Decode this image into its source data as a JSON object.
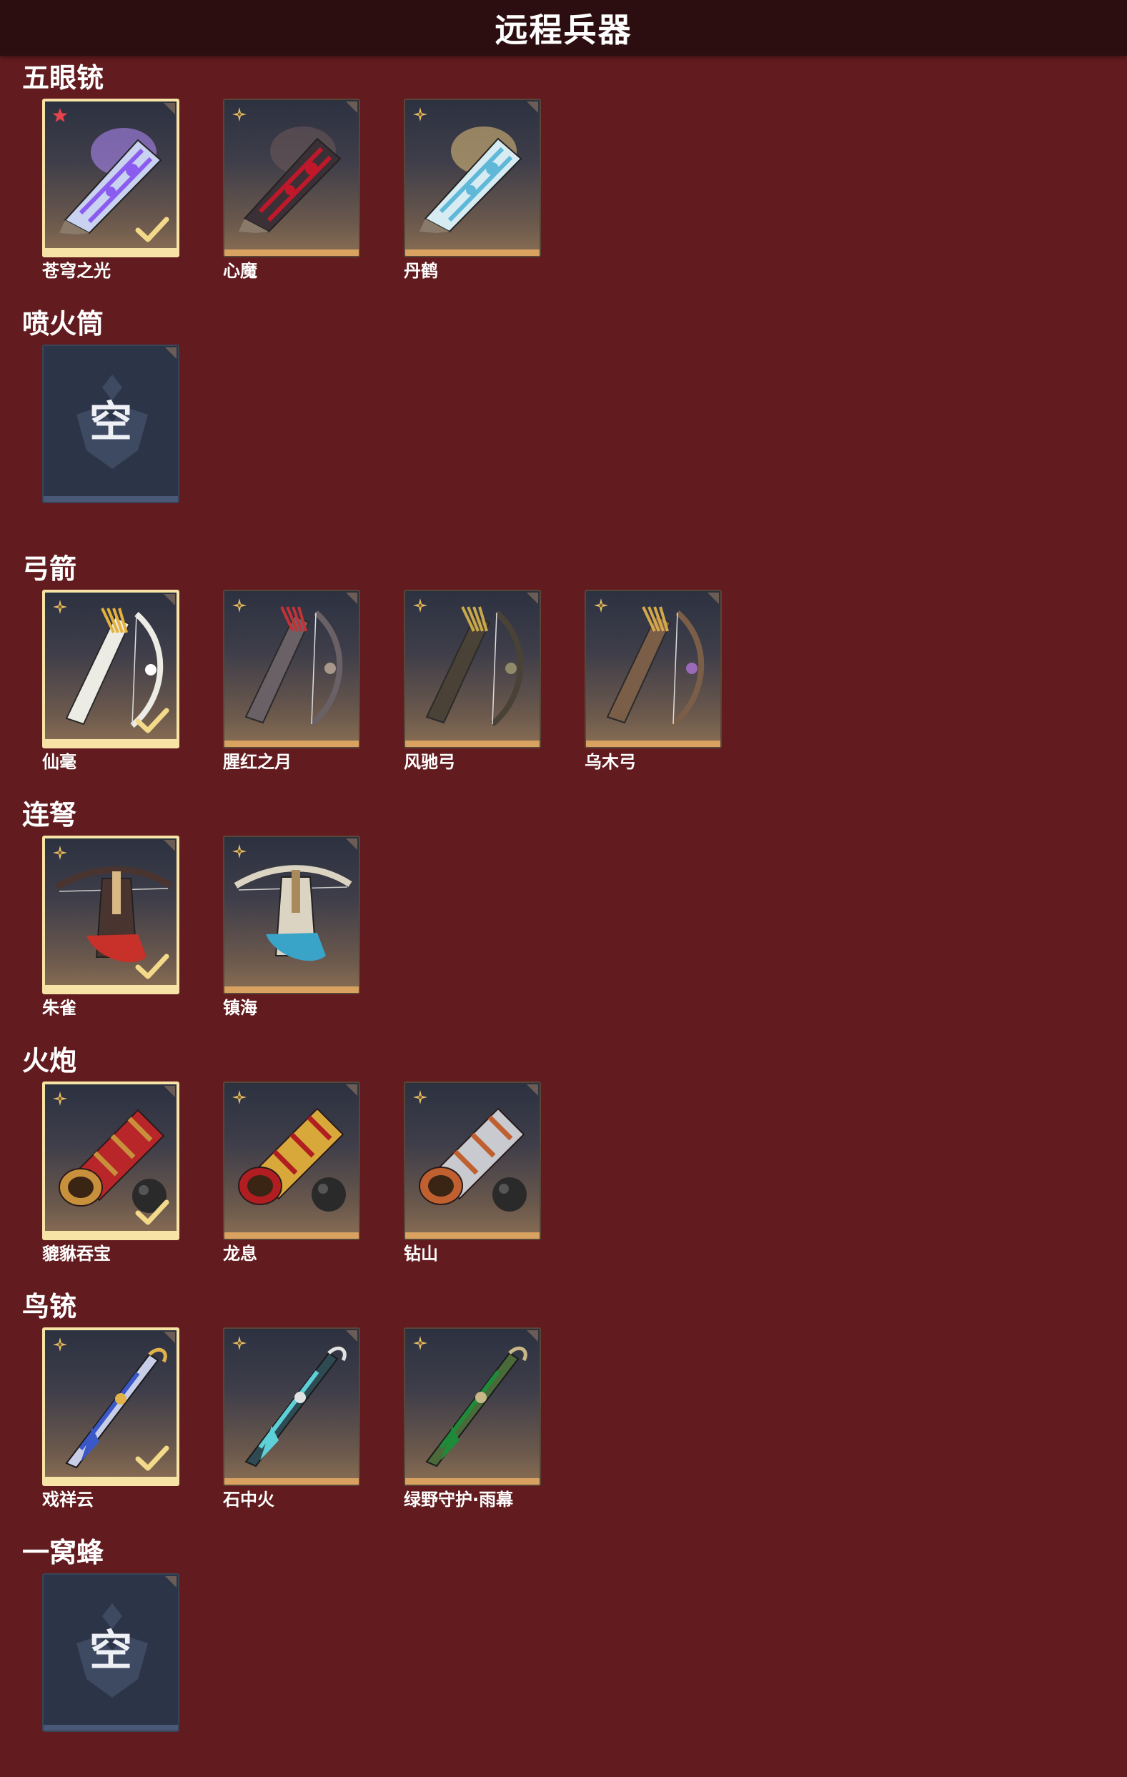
{
  "header": {
    "title": "远程兵器"
  },
  "colors": {
    "background": "#621b1e",
    "header_bg": "#2d0e10",
    "selected_border": "#f6e3a5",
    "card_bottom": "#d9a261",
    "empty_card": "#2c3548"
  },
  "empty_label": "空",
  "sections": [
    {
      "title": "五眼铳",
      "items": [
        {
          "name": "苍穹之光",
          "selected": true,
          "rarity": "star",
          "empty": false,
          "art": "glowing-hand-cannon"
        },
        {
          "name": "心魔",
          "selected": false,
          "rarity": "diamond",
          "empty": false,
          "art": "dark-demon-cannon"
        },
        {
          "name": "丹鹤",
          "selected": false,
          "rarity": "diamond",
          "empty": false,
          "art": "crane-cannon"
        }
      ]
    },
    {
      "title": "喷火筒",
      "items": [
        {
          "name": "",
          "selected": false,
          "rarity": "none",
          "empty": true,
          "art": "empty-slot"
        }
      ]
    },
    {
      "title": "弓箭",
      "items": [
        {
          "name": "仙毫",
          "selected": true,
          "rarity": "diamond",
          "empty": false,
          "art": "white-feather-bow"
        },
        {
          "name": "腥红之月",
          "selected": false,
          "rarity": "diamond",
          "empty": false,
          "art": "red-moon-bow"
        },
        {
          "name": "风驰弓",
          "selected": false,
          "rarity": "diamond",
          "empty": false,
          "art": "wind-bow"
        },
        {
          "name": "乌木弓",
          "selected": false,
          "rarity": "diamond",
          "empty": false,
          "art": "ebony-bow"
        }
      ]
    },
    {
      "title": "连弩",
      "items": [
        {
          "name": "朱雀",
          "selected": true,
          "rarity": "diamond",
          "empty": false,
          "art": "vermilion-crossbow"
        },
        {
          "name": "镇海",
          "selected": false,
          "rarity": "diamond",
          "empty": false,
          "art": "sea-crossbow"
        }
      ]
    },
    {
      "title": "火炮",
      "items": [
        {
          "name": "貔貅吞宝",
          "selected": true,
          "rarity": "diamond",
          "empty": false,
          "art": "red-cannon"
        },
        {
          "name": "龙息",
          "selected": false,
          "rarity": "diamond",
          "empty": false,
          "art": "golden-dragon-cannon"
        },
        {
          "name": "钻山",
          "selected": false,
          "rarity": "diamond",
          "empty": false,
          "art": "silver-cannon"
        }
      ]
    },
    {
      "title": "鸟铳",
      "items": [
        {
          "name": "戏祥云",
          "selected": true,
          "rarity": "diamond",
          "empty": false,
          "art": "cloud-musket"
        },
        {
          "name": "石中火",
          "selected": false,
          "rarity": "diamond",
          "empty": false,
          "art": "stone-fire-musket"
        },
        {
          "name": "绿野守护·雨幕",
          "selected": false,
          "rarity": "diamond",
          "empty": false,
          "art": "green-musket"
        }
      ]
    },
    {
      "title": "一窝蜂",
      "items": [
        {
          "name": "",
          "selected": false,
          "rarity": "none",
          "empty": true,
          "art": "empty-slot"
        }
      ]
    }
  ]
}
